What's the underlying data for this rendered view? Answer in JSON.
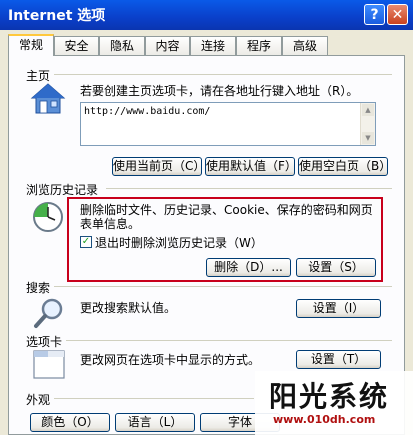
{
  "window": {
    "title": "Internet 选项",
    "help_label": "?",
    "close_label": "✕"
  },
  "tabs": [
    {
      "label": "常规",
      "active": true
    },
    {
      "label": "安全"
    },
    {
      "label": "隐私"
    },
    {
      "label": "内容"
    },
    {
      "label": "连接"
    },
    {
      "label": "程序"
    },
    {
      "label": "高级"
    }
  ],
  "home": {
    "group_label": "主页",
    "icon": "home-icon",
    "description": "若要创建主页选项卡，请在各地址行键入地址（R）。",
    "url": "http://www.baidu.com/",
    "buttons": [
      "使用当前页（C）",
      "使用默认值（F）",
      "使用空白页（B）"
    ]
  },
  "history": {
    "group_label": "浏览历史记录",
    "icon": "history-clock-icon",
    "description_line1": "删除临时文件、历史记录、Cookie、保存的密码和网页",
    "description_line2": "表单信息。",
    "checkbox_label": "退出时删除浏览历史记录（W）",
    "checkbox_checked": true,
    "delete_button": "删除（D）...",
    "settings_button": "设置（S）",
    "highlight_color": "#c8001c"
  },
  "search": {
    "group_label": "搜索",
    "icon": "magnifier-icon",
    "description": "更改搜索默认值。",
    "settings_button": "设置（I）"
  },
  "tabs_group": {
    "group_label": "选项卡",
    "icon": "tabs-window-icon",
    "description": "更改网页在选项卡中显示的方式。",
    "settings_button": "设置（T）"
  },
  "appearance": {
    "group_label": "外观",
    "buttons": [
      "颜色（O）",
      "语言（L）",
      "字体"
    ]
  },
  "watermark": {
    "title": "阳光系统",
    "url": "www.010dh.com"
  }
}
